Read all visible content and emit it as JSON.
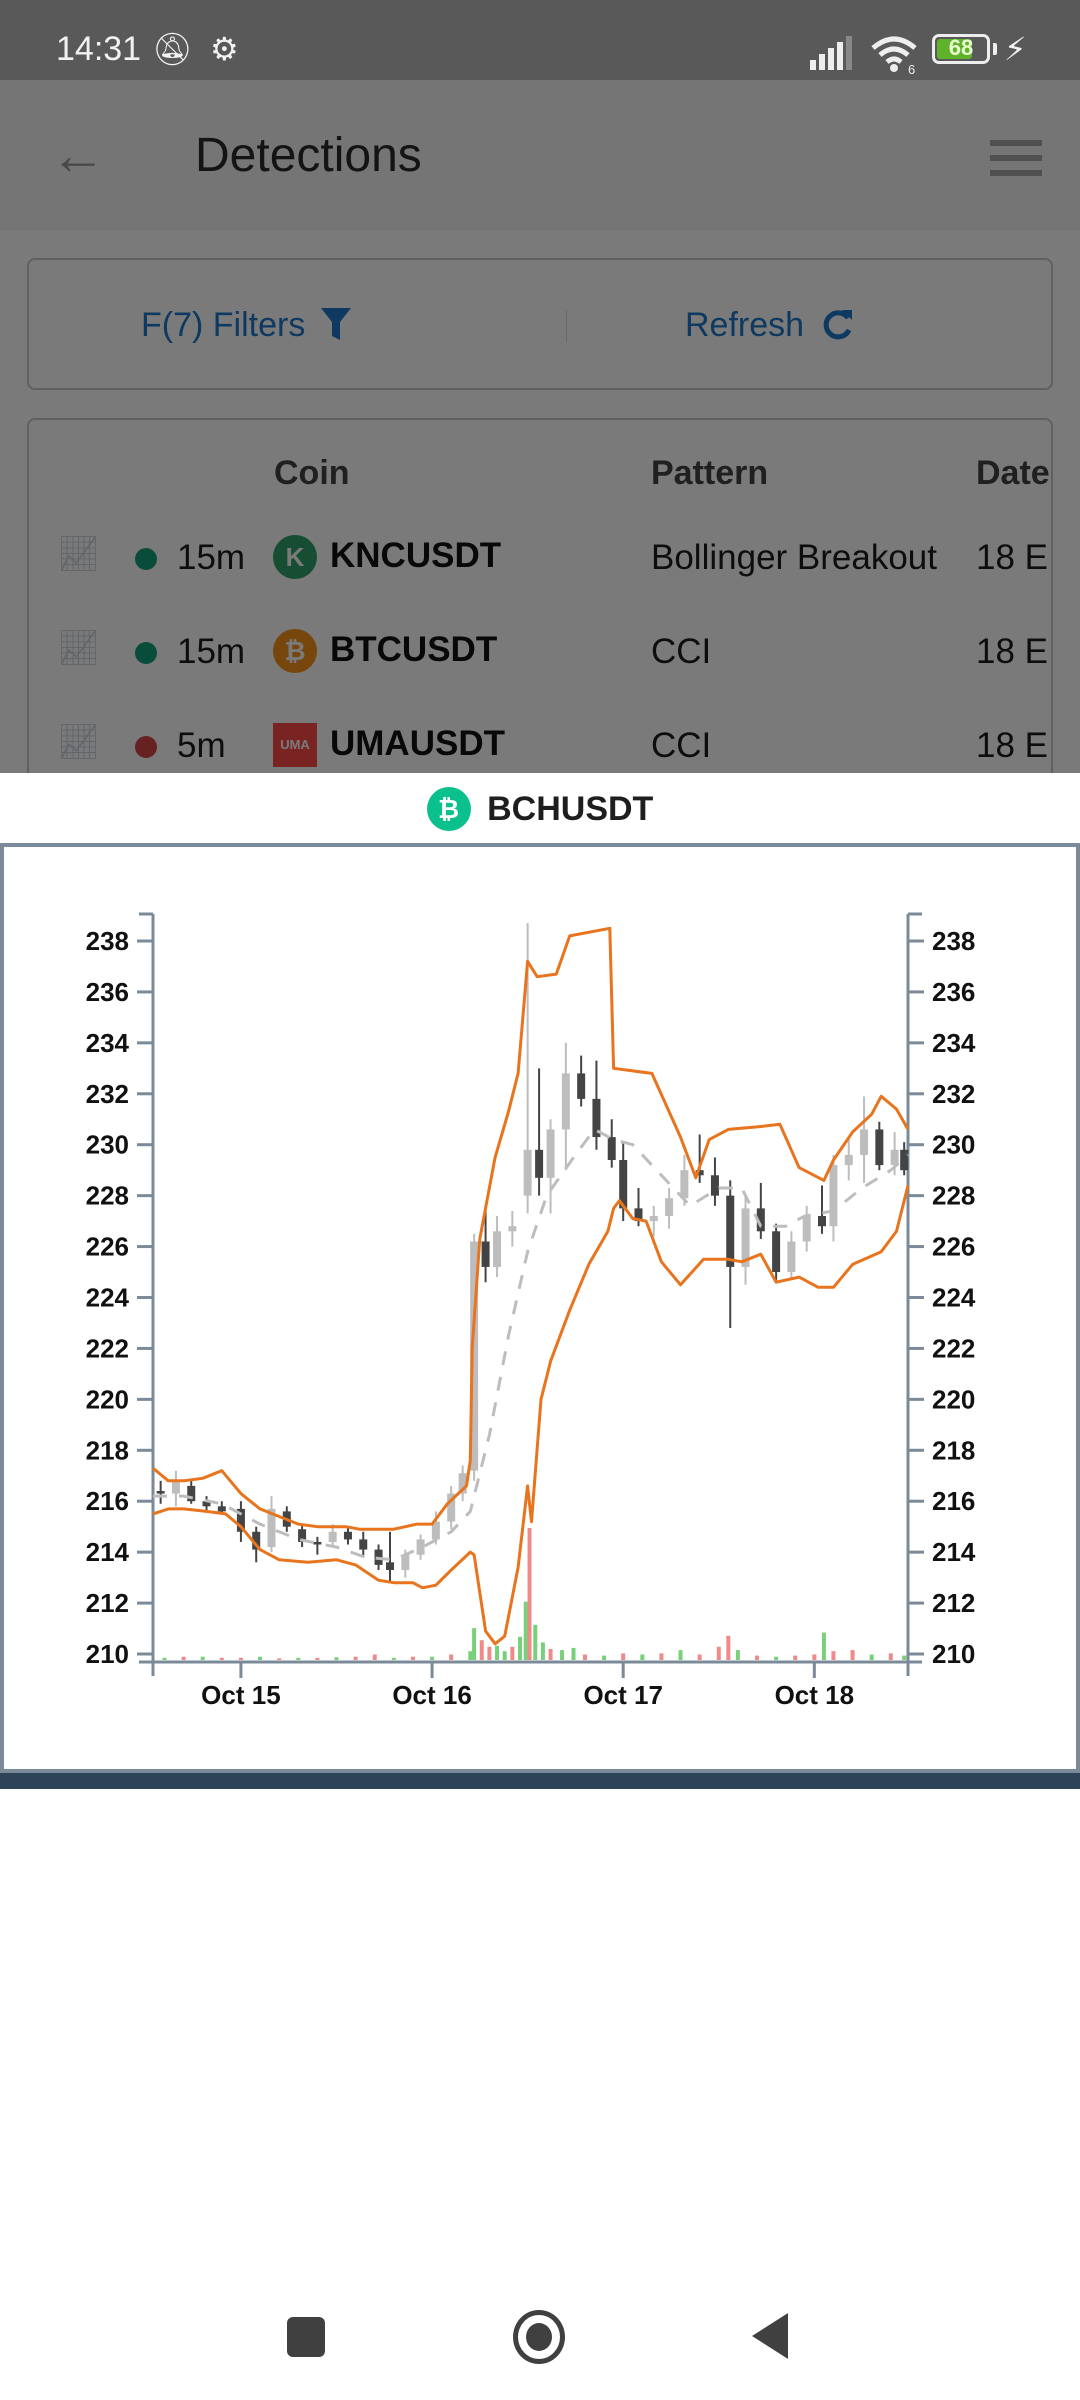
{
  "status_bar": {
    "time": "14:31",
    "battery_level": "68",
    "icons": [
      "vibrate-off-icon",
      "android-debug-icon",
      "signal-icon",
      "wifi-icon",
      "battery-icon",
      "charging-icon"
    ],
    "wifi_label": "6"
  },
  "header": {
    "title": "Detections",
    "back_icon": "arrow-left-icon",
    "menu_icon": "hamburger-menu-icon"
  },
  "actions": {
    "filters_label": "F(7) Filters",
    "filters_icon": "funnel-icon",
    "refresh_label": "Refresh",
    "refresh_icon": "refresh-icon"
  },
  "table": {
    "columns": [
      "Coin",
      "Pattern",
      "Date"
    ],
    "rows": [
      {
        "timeframe": "15m",
        "status": "green",
        "coin": "KNCUSDT",
        "coin_color": "#31a169",
        "coin_glyph": "K",
        "pattern": "Bollinger Breakout",
        "date": "18 E"
      },
      {
        "timeframe": "15m",
        "status": "green",
        "coin": "BTCUSDT",
        "coin_color": "#f7931a",
        "coin_glyph": "₿",
        "pattern": "CCI",
        "date": "18 E"
      },
      {
        "timeframe": "5m",
        "status": "red",
        "coin": "UMAUSDT",
        "coin_color": "#ff4a4a",
        "coin_glyph": "UMA",
        "pattern": "CCI",
        "date": "18 E"
      }
    ],
    "status_colors": {
      "green": "#14a07a",
      "red": "#d64545"
    }
  },
  "modal": {
    "coin": "BCHUSDT",
    "coin_glyph": "₿",
    "coin_color": "#0ac18e"
  },
  "chart_data": {
    "type": "candlestick",
    "title": "BCHUSDT",
    "overlays": [
      "Bollinger upper band",
      "Bollinger lower band",
      "SMA middle band (dashed)",
      "volume bars"
    ],
    "colors": {
      "band": "#e8741e",
      "sma": "#bdbdbd",
      "candle_up": "#bdbdbd",
      "candle_down": "#444444",
      "vol_up": "#78d07a",
      "vol_down": "#f08a8a",
      "axis": "#7a8a99"
    },
    "ylim": [
      209.7,
      239.0
    ],
    "yticks": [
      210,
      212,
      214,
      216,
      218,
      220,
      222,
      224,
      226,
      228,
      230,
      232,
      234,
      236,
      238
    ],
    "ytick_labels": [
      "210",
      "212",
      "214",
      "216",
      "218",
      "220",
      "222",
      "224",
      "226",
      "228",
      "230",
      "232",
      "234",
      "236",
      "238"
    ],
    "x_range_days": [
      14.54,
      18.49
    ],
    "xticks": [
      15,
      16,
      17,
      18
    ],
    "xtick_labels": [
      "Oct 15",
      "Oct 16",
      "Oct 17",
      "Oct 18"
    ],
    "axes": "left and right y-axes, bottom x-axis",
    "upper_band": [
      [
        14.54,
        217.3
      ],
      [
        14.62,
        216.8
      ],
      [
        14.7,
        216.8
      ],
      [
        14.8,
        216.9
      ],
      [
        14.9,
        217.2
      ],
      [
        15.0,
        216.3
      ],
      [
        15.1,
        215.7
      ],
      [
        15.3,
        215.1
      ],
      [
        15.4,
        215.0
      ],
      [
        15.55,
        215.0
      ],
      [
        15.62,
        214.9
      ],
      [
        15.8,
        214.9
      ],
      [
        15.92,
        215.1
      ],
      [
        16.0,
        215.1
      ],
      [
        16.08,
        215.9
      ],
      [
        16.18,
        216.6
      ],
      [
        16.2,
        217.6
      ],
      [
        16.21,
        222
      ],
      [
        16.25,
        226.3
      ],
      [
        16.33,
        229.5
      ],
      [
        16.4,
        231.3
      ],
      [
        16.45,
        232.8
      ],
      [
        16.5,
        237.2
      ],
      [
        16.55,
        236.6
      ],
      [
        16.65,
        236.7
      ],
      [
        16.72,
        238.2
      ],
      [
        16.93,
        238.5
      ],
      [
        16.95,
        233.0
      ],
      [
        17.05,
        232.9
      ],
      [
        17.15,
        232.8
      ],
      [
        17.3,
        230.3
      ],
      [
        17.38,
        228.7
      ],
      [
        17.45,
        230.2
      ],
      [
        17.55,
        230.6
      ],
      [
        17.7,
        230.7
      ],
      [
        17.82,
        230.8
      ],
      [
        17.92,
        229.1
      ],
      [
        18.05,
        228.6
      ],
      [
        18.1,
        229.4
      ],
      [
        18.2,
        230.5
      ],
      [
        18.3,
        231.2
      ],
      [
        18.35,
        231.9
      ],
      [
        18.43,
        231.4
      ],
      [
        18.49,
        230.6
      ]
    ],
    "lower_band": [
      [
        14.54,
        215.5
      ],
      [
        14.62,
        215.7
      ],
      [
        14.7,
        215.7
      ],
      [
        14.82,
        215.6
      ],
      [
        14.92,
        215.5
      ],
      [
        15.0,
        215.0
      ],
      [
        15.1,
        214.1
      ],
      [
        15.2,
        213.7
      ],
      [
        15.35,
        213.6
      ],
      [
        15.5,
        213.7
      ],
      [
        15.6,
        213.5
      ],
      [
        15.72,
        212.9
      ],
      [
        15.8,
        212.8
      ],
      [
        15.9,
        212.8
      ],
      [
        15.95,
        212.6
      ],
      [
        16.02,
        212.7
      ],
      [
        16.1,
        213.3
      ],
      [
        16.2,
        214.0
      ],
      [
        16.22,
        213.9
      ],
      [
        16.28,
        210.9
      ],
      [
        16.33,
        210.4
      ],
      [
        16.38,
        210.7
      ],
      [
        16.45,
        213.4
      ],
      [
        16.5,
        216.6
      ],
      [
        16.52,
        215.2
      ],
      [
        16.57,
        220.0
      ],
      [
        16.62,
        221.5
      ],
      [
        16.72,
        223.5
      ],
      [
        16.82,
        225.3
      ],
      [
        16.92,
        226.6
      ],
      [
        16.95,
        227.5
      ],
      [
        16.98,
        227.8
      ],
      [
        17.05,
        227.1
      ],
      [
        17.12,
        227.0
      ],
      [
        17.2,
        225.4
      ],
      [
        17.3,
        224.5
      ],
      [
        17.42,
        225.5
      ],
      [
        17.55,
        225.5
      ],
      [
        17.62,
        225.4
      ],
      [
        17.72,
        225.7
      ],
      [
        17.8,
        224.6
      ],
      [
        17.92,
        224.8
      ],
      [
        18.02,
        224.4
      ],
      [
        18.1,
        224.4
      ],
      [
        18.2,
        225.3
      ],
      [
        18.35,
        225.8
      ],
      [
        18.43,
        226.6
      ],
      [
        18.49,
        228.4
      ]
    ],
    "sma": [
      [
        14.54,
        216.2
      ],
      [
        14.7,
        216.2
      ],
      [
        14.9,
        215.9
      ],
      [
        15.1,
        215.1
      ],
      [
        15.3,
        214.5
      ],
      [
        15.5,
        214.2
      ],
      [
        15.65,
        213.8
      ],
      [
        15.8,
        213.7
      ],
      [
        15.95,
        214.2
      ],
      [
        16.1,
        214.8
      ],
      [
        16.2,
        215.6
      ],
      [
        16.3,
        218.6
      ],
      [
        16.4,
        222.5
      ],
      [
        16.5,
        225.8
      ],
      [
        16.6,
        228.0
      ],
      [
        16.75,
        229.6
      ],
      [
        16.85,
        230.6
      ],
      [
        16.95,
        230.2
      ],
      [
        17.05,
        230.0
      ],
      [
        17.2,
        228.8
      ],
      [
        17.35,
        227.6
      ],
      [
        17.5,
        228.3
      ],
      [
        17.62,
        228.3
      ],
      [
        17.72,
        226.8
      ],
      [
        17.85,
        226.8
      ],
      [
        17.95,
        227.2
      ],
      [
        18.1,
        227.4
      ],
      [
        18.25,
        228.3
      ],
      [
        18.4,
        229.0
      ],
      [
        18.49,
        229.6
      ]
    ],
    "candles_ohlc_sample": [
      [
        14.58,
        216.4,
        216.8,
        215.9,
        216.3
      ],
      [
        14.66,
        216.3,
        217.2,
        215.8,
        216.8
      ],
      [
        14.74,
        216.6,
        216.8,
        215.9,
        216.0
      ],
      [
        14.82,
        216.0,
        216.2,
        215.6,
        215.8
      ],
      [
        14.9,
        215.8,
        216.0,
        215.5,
        215.6
      ],
      [
        15.0,
        215.7,
        216.0,
        214.4,
        214.8
      ],
      [
        15.08,
        214.8,
        215.0,
        213.6,
        214.1
      ],
      [
        15.16,
        214.2,
        216.2,
        214.0,
        215.7
      ],
      [
        15.24,
        215.6,
        215.8,
        214.8,
        215.0
      ],
      [
        15.32,
        214.9,
        215.1,
        214.2,
        214.4
      ],
      [
        15.4,
        214.4,
        214.6,
        213.9,
        214.3
      ],
      [
        15.48,
        214.4,
        215.1,
        214.2,
        214.8
      ],
      [
        15.56,
        214.8,
        215.0,
        214.3,
        214.5
      ],
      [
        15.64,
        214.5,
        214.8,
        213.8,
        214.1
      ],
      [
        15.72,
        214.1,
        214.3,
        213.3,
        213.5
      ],
      [
        15.78,
        213.6,
        214.8,
        212.8,
        213.3
      ],
      [
        15.86,
        213.3,
        214.1,
        213.0,
        213.9
      ],
      [
        15.94,
        213.9,
        214.7,
        213.7,
        214.5
      ],
      [
        16.02,
        214.5,
        215.6,
        214.3,
        215.2
      ],
      [
        16.1,
        215.2,
        216.6,
        214.9,
        216.3
      ],
      [
        16.16,
        216.3,
        217.4,
        216.0,
        217.1
      ],
      [
        16.22,
        217.2,
        226.5,
        216.8,
        226.2
      ],
      [
        16.28,
        226.2,
        227.5,
        224.6,
        225.2
      ],
      [
        16.34,
        225.2,
        227.2,
        224.8,
        226.6
      ],
      [
        16.42,
        226.6,
        227.4,
        226.0,
        226.8
      ],
      [
        16.5,
        228.0,
        238.7,
        227.3,
        229.8
      ],
      [
        16.56,
        229.8,
        233.0,
        228.0,
        228.7
      ],
      [
        16.62,
        228.7,
        231.0,
        227.3,
        230.6
      ],
      [
        16.7,
        230.6,
        234.0,
        229.0,
        232.8
      ],
      [
        16.78,
        232.8,
        233.5,
        231.5,
        231.8
      ],
      [
        16.86,
        231.8,
        233.3,
        229.8,
        230.3
      ],
      [
        16.94,
        230.3,
        231.0,
        229.1,
        229.4
      ],
      [
        17.0,
        229.4,
        230.1,
        227.0,
        227.5
      ],
      [
        17.08,
        227.5,
        228.3,
        226.8,
        227.0
      ],
      [
        17.16,
        227.0,
        227.6,
        226.4,
        227.2
      ],
      [
        17.24,
        227.2,
        228.3,
        226.7,
        227.9
      ],
      [
        17.32,
        227.9,
        229.6,
        227.6,
        229.0
      ],
      [
        17.4,
        229.0,
        230.4,
        228.5,
        228.8
      ],
      [
        17.48,
        228.8,
        229.5,
        227.6,
        228.0
      ],
      [
        17.56,
        228.0,
        228.6,
        222.8,
        225.2
      ],
      [
        17.64,
        225.2,
        228.0,
        224.5,
        227.5
      ],
      [
        17.72,
        227.5,
        228.5,
        226.3,
        226.6
      ],
      [
        17.8,
        226.6,
        226.9,
        224.6,
        225.0
      ],
      [
        17.88,
        225.0,
        226.6,
        224.7,
        226.2
      ],
      [
        17.96,
        226.2,
        227.6,
        225.8,
        227.2
      ],
      [
        18.04,
        227.2,
        228.4,
        226.5,
        226.8
      ],
      [
        18.1,
        226.8,
        229.6,
        226.2,
        229.2
      ],
      [
        18.18,
        229.2,
        230.2,
        228.6,
        229.6
      ],
      [
        18.26,
        229.6,
        231.9,
        228.5,
        230.6
      ],
      [
        18.34,
        230.6,
        230.9,
        229.0,
        229.2
      ],
      [
        18.42,
        229.2,
        230.5,
        228.8,
        229.8
      ],
      [
        18.47,
        229.8,
        230.1,
        228.8,
        229.0
      ]
    ],
    "volume_note": "relative volume bars along bottom; spikes near Oct 16 and around 16.5",
    "volume_sample": [
      [
        14.6,
        0.2,
        "up"
      ],
      [
        14.7,
        0.3,
        "down"
      ],
      [
        14.8,
        0.3,
        "up"
      ],
      [
        14.9,
        0.2,
        "down"
      ],
      [
        15.0,
        0.2,
        "down"
      ],
      [
        15.1,
        0.3,
        "up"
      ],
      [
        15.2,
        0.15,
        "down"
      ],
      [
        15.3,
        0.2,
        "up"
      ],
      [
        15.4,
        0.2,
        "down"
      ],
      [
        15.5,
        0.25,
        "up"
      ],
      [
        15.6,
        0.3,
        "down"
      ],
      [
        15.7,
        0.5,
        "down"
      ],
      [
        15.8,
        0.2,
        "up"
      ],
      [
        15.9,
        0.3,
        "down"
      ],
      [
        16.0,
        0.3,
        "up"
      ],
      [
        16.1,
        0.5,
        "down"
      ],
      [
        16.2,
        0.8,
        "up"
      ],
      [
        16.22,
        2.9,
        "up"
      ],
      [
        16.26,
        1.8,
        "down"
      ],
      [
        16.3,
        1.2,
        "down"
      ],
      [
        16.34,
        1.3,
        "up"
      ],
      [
        16.38,
        0.8,
        "up"
      ],
      [
        16.42,
        1.2,
        "down"
      ],
      [
        16.46,
        2.1,
        "up"
      ],
      [
        16.49,
        5.3,
        "up"
      ],
      [
        16.51,
        12.0,
        "down"
      ],
      [
        16.54,
        3.2,
        "up"
      ],
      [
        16.58,
        1.6,
        "up"
      ],
      [
        16.62,
        1.0,
        "down"
      ],
      [
        16.68,
        0.9,
        "up"
      ],
      [
        16.74,
        1.1,
        "up"
      ],
      [
        16.8,
        0.5,
        "down"
      ],
      [
        16.9,
        0.4,
        "up"
      ],
      [
        17.0,
        0.6,
        "down"
      ],
      [
        17.1,
        0.5,
        "up"
      ],
      [
        17.2,
        0.6,
        "down"
      ],
      [
        17.3,
        0.9,
        "up"
      ],
      [
        17.4,
        0.5,
        "down"
      ],
      [
        17.5,
        1.2,
        "down"
      ],
      [
        17.55,
        2.2,
        "down"
      ],
      [
        17.6,
        0.9,
        "up"
      ],
      [
        17.7,
        0.4,
        "down"
      ],
      [
        17.8,
        0.3,
        "up"
      ],
      [
        17.9,
        0.4,
        "down"
      ],
      [
        18.0,
        0.5,
        "down"
      ],
      [
        18.05,
        2.5,
        "up"
      ],
      [
        18.1,
        0.8,
        "down"
      ],
      [
        18.2,
        0.9,
        "down"
      ],
      [
        18.3,
        0.5,
        "up"
      ],
      [
        18.4,
        0.6,
        "down"
      ],
      [
        18.47,
        0.4,
        "up"
      ]
    ]
  },
  "nav_bar": {
    "recent_icon": "recent-apps-icon",
    "home_icon": "home-icon",
    "back_icon": "back-triangle-icon"
  }
}
